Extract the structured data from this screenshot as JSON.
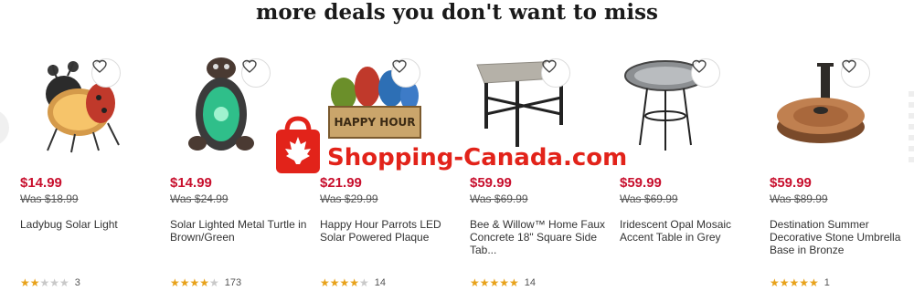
{
  "heading": "more deals you don't want to miss",
  "products": [
    {
      "price": "$14.99",
      "was": "Was $18.99",
      "title": "Ladybug Solar Light",
      "rating": 2,
      "reviews": "3",
      "icon": "ladybug-solar-light-image"
    },
    {
      "price": "$14.99",
      "was": "Was $24.99",
      "title": "Solar Lighted Metal Turtle in Brown/Green",
      "rating": 4,
      "reviews": "173",
      "icon": "turtle-solar-light-image"
    },
    {
      "price": "$21.99",
      "was": "Was $29.99",
      "title": "Happy Hour Parrots LED Solar Powered Plaque",
      "rating": 4,
      "reviews": "14",
      "icon": "parrots-plaque-image"
    },
    {
      "price": "$59.99",
      "was": "Was $69.99",
      "title": "Bee & Willow™ Home Faux Concrete 18\" Square Side Tab...",
      "rating": 5,
      "reviews": "14",
      "icon": "side-table-image"
    },
    {
      "price": "$59.99",
      "was": "Was $69.99",
      "title": "Iridescent Opal Mosaic Accent Table in Grey",
      "rating": 0,
      "reviews": "",
      "icon": "mosaic-table-image"
    },
    {
      "price": "$59.99",
      "was": "Was $89.99",
      "title": "Destination Summer Decorative Stone Umbrella Base in Bronze",
      "rating": 5,
      "reviews": "1",
      "icon": "umbrella-base-image"
    }
  ],
  "plaque_text": "HAPPY HOUR",
  "watermark": "Shopping-Canada.com",
  "colors": {
    "price": "#c8102e",
    "star": "#e8a21a",
    "watermark": "#e2231a"
  }
}
